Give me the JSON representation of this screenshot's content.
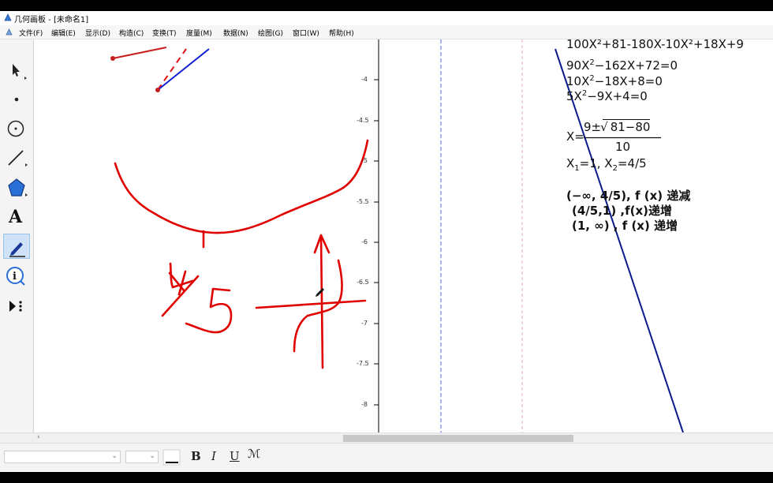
{
  "window": {
    "title": "几何画板 - [未命名1]"
  },
  "menu": [
    "文件(F)",
    "编辑(E)",
    "显示(D)",
    "构造(C)",
    "变换(T)",
    "度量(M)",
    "数据(N)",
    "绘图(G)",
    "窗口(W)",
    "帮助(H)"
  ],
  "tools": [
    {
      "name": "arrow-select-tool",
      "icon": "arrow-icon"
    },
    {
      "name": "point-tool",
      "icon": "point-icon"
    },
    {
      "name": "compass-tool",
      "icon": "circle-icon"
    },
    {
      "name": "straightedge-tool",
      "icon": "segment-icon"
    },
    {
      "name": "polygon-tool",
      "icon": "polygon-icon"
    },
    {
      "name": "text-tool",
      "icon": "text-a-icon",
      "label": "A"
    },
    {
      "name": "marker-tool",
      "icon": "marker-pen-icon",
      "active": true
    },
    {
      "name": "information-tool",
      "icon": "info-icon"
    },
    {
      "name": "custom-tool",
      "icon": "play-more-icon"
    }
  ],
  "axis": {
    "labels": [
      "-4",
      "-4.5",
      "-5",
      "-5.5",
      "-6",
      "-6.5",
      "-7",
      "-7.5",
      "-8"
    ]
  },
  "math": {
    "line0": "100X²+81-180X-10X²+18X+9",
    "line1_base": "90X",
    "line1_exp": "2",
    "line1_rest": "−162X+72=0",
    "line2_base": "10X",
    "line2_exp": "2",
    "line2_rest": "−18X+8=0",
    "line3_base": "5X",
    "line3_exp": "2",
    "line3_rest": "−9X+4=0",
    "x_eq": "X=",
    "numerator_pre": "9±",
    "radicand": "81−80",
    "denominator": "10",
    "roots_x1": "X",
    "roots_sub1": "1",
    "roots_mid": "=1,  X",
    "roots_sub2": "2",
    "roots_end": "=4/5",
    "interval1": "(−∞,  4/5), f (x) 递减",
    "interval2": "(4/5,1) ,f(x)递增",
    "interval3": "(1,  ∞) , f (x) 递增"
  },
  "formatbar": {
    "bold": "B",
    "italic": "I",
    "underline": "U",
    "special": "ℳ"
  },
  "colors": {
    "ink": "#e00000",
    "line": "#0a1a8a",
    "segment": "#1020d0",
    "guide_blue": "#5566cc",
    "guide_pink": "#e8a6c8"
  }
}
